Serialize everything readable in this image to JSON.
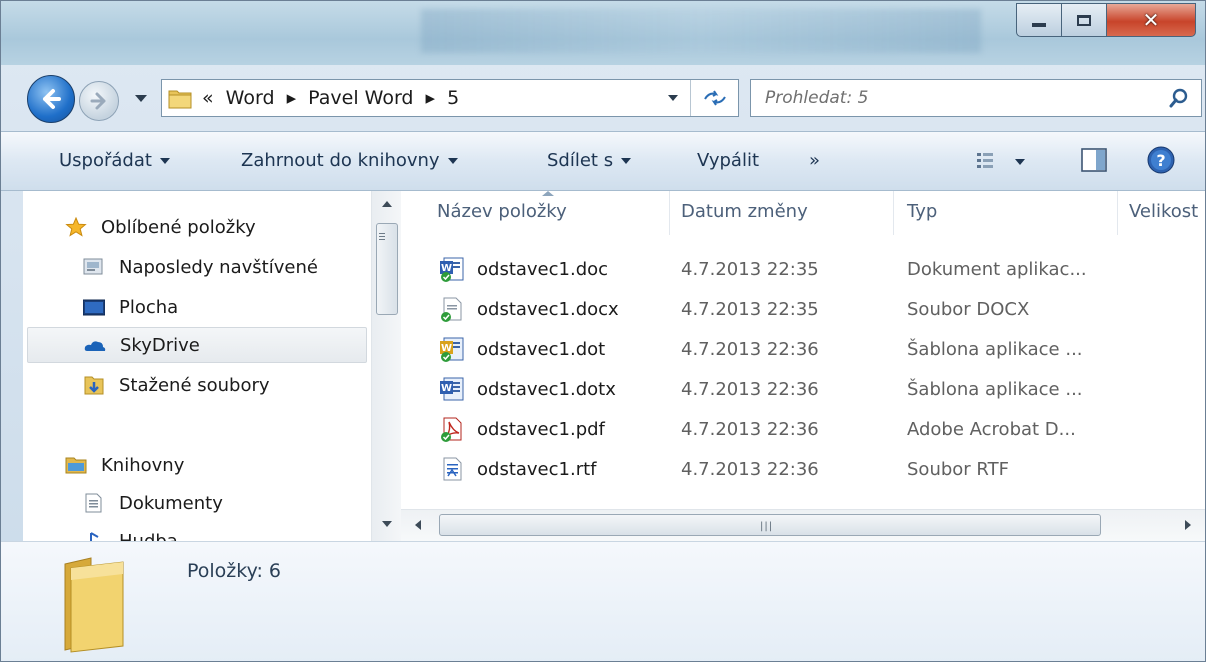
{
  "window": {
    "controls": {
      "minimize": "minimize",
      "maximize": "maximize",
      "close": "close"
    }
  },
  "address": {
    "overflow": "«",
    "segments": [
      "Word",
      "Pavel Word",
      "5"
    ],
    "separator": "▸"
  },
  "search": {
    "placeholder": "Prohledat: 5"
  },
  "toolbar": {
    "organize": "Uspořádat",
    "include_in_library": "Zahrnout do knihovny",
    "share_with": "Sdílet s",
    "burn": "Vypálit",
    "more": "»"
  },
  "nav": {
    "items": [
      {
        "label": "Oblíbené položky",
        "icon": "star-icon"
      },
      {
        "label": "Naposledy navštívené",
        "icon": "recent-places-icon"
      },
      {
        "label": "Plocha",
        "icon": "desktop-icon"
      },
      {
        "label": "SkyDrive",
        "icon": "skydrive-icon"
      },
      {
        "label": "Stažené soubory",
        "icon": "downloads-icon"
      },
      {
        "label": "Knihovny",
        "icon": "libraries-icon"
      },
      {
        "label": "Dokumenty",
        "icon": "documents-icon"
      },
      {
        "label": "Hudba",
        "icon": "music-icon"
      }
    ]
  },
  "filelist": {
    "columns": {
      "name": "Název položky",
      "date": "Datum změny",
      "type": "Typ",
      "size": "Velikost"
    },
    "rows": [
      {
        "name": "odstavec1.doc",
        "date": "4.7.2013 22:35",
        "type": "Dokument aplikac...",
        "icon": "word-doc-icon"
      },
      {
        "name": "odstavec1.docx",
        "date": "4.7.2013 22:35",
        "type": "Soubor DOCX",
        "icon": "docx-file-icon"
      },
      {
        "name": "odstavec1.dot",
        "date": "4.7.2013 22:36",
        "type": "Šablona aplikace ...",
        "icon": "word-template-icon"
      },
      {
        "name": "odstavec1.dotx",
        "date": "4.7.2013 22:36",
        "type": "Šablona aplikace ...",
        "icon": "word-template-x-icon"
      },
      {
        "name": "odstavec1.pdf",
        "date": "4.7.2013 22:36",
        "type": "Adobe Acrobat D...",
        "icon": "pdf-file-icon"
      },
      {
        "name": "odstavec1.rtf",
        "date": "4.7.2013 22:36",
        "type": "Soubor RTF",
        "icon": "rtf-file-icon"
      }
    ]
  },
  "details": {
    "count": "Položky: 6"
  },
  "colors": {
    "accent": "#1f6fc9",
    "toolbar_text": "#1d3552",
    "close": "#c8442a"
  }
}
